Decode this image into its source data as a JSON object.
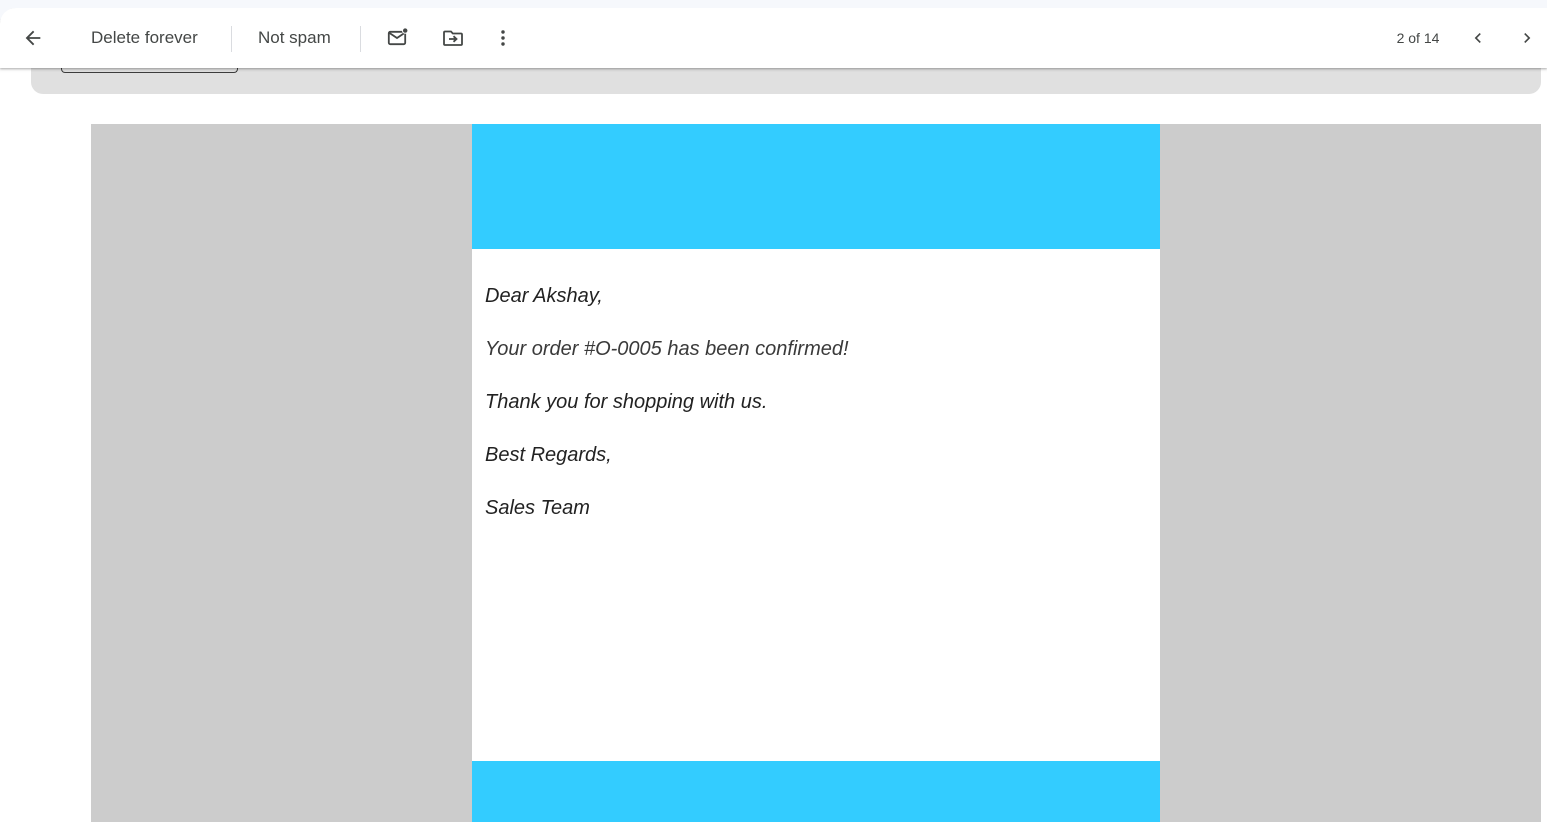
{
  "toolbar": {
    "back_icon": "arrow-left-icon",
    "delete_forever_label": "Delete forever",
    "not_spam_label": "Not spam",
    "mark_unread_icon": "mark-unread-icon",
    "move_to_icon": "move-to-folder-icon",
    "more_icon": "more-vert-icon",
    "pagination": "2 of 14",
    "prev_icon": "chevron-left-icon",
    "next_icon": "chevron-right-icon"
  },
  "email": {
    "colors": {
      "band": "#33ccff",
      "background": "#cccccc"
    },
    "greeting": "Dear Akshay,",
    "order_line": "Your order #O-0005 has been confirmed!",
    "thanks_line": "Thank you for shopping with us.",
    "closing": "Best Regards,",
    "signature": "Sales Team"
  }
}
